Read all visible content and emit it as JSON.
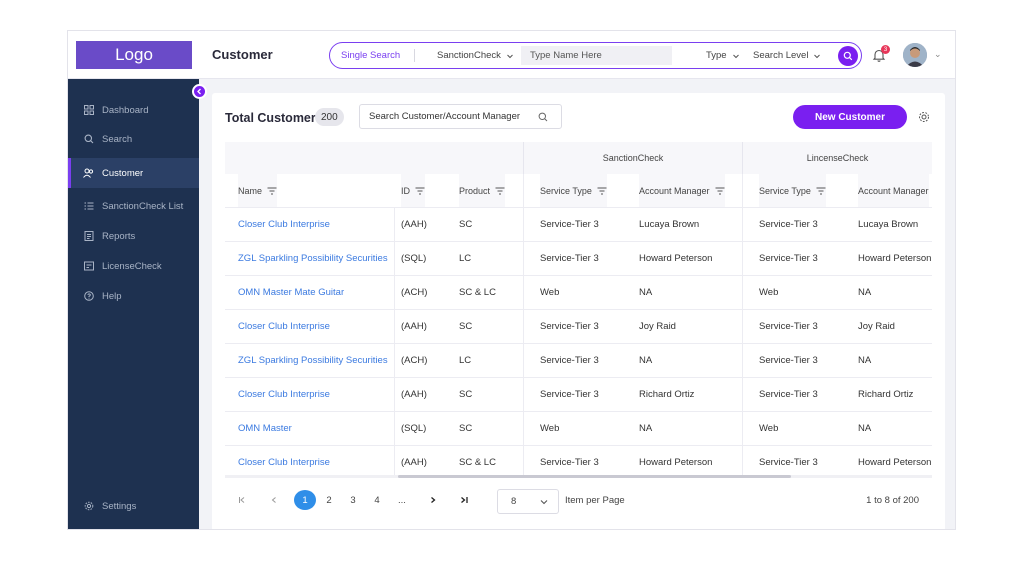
{
  "header": {
    "logo": "Logo",
    "page_title": "Customer",
    "search": {
      "mode": "Single Search",
      "source": "SanctionCheck",
      "placeholder": "Type Name Here",
      "type_label": "Type",
      "level_label": "Search Level"
    },
    "notification_count": "3"
  },
  "sidebar": {
    "items": [
      {
        "label": "Dashboard",
        "icon": "dashboard-icon"
      },
      {
        "label": "Search",
        "icon": "search-icon"
      },
      {
        "label": "Customer",
        "icon": "users-icon",
        "active": true
      },
      {
        "label": "SanctionCheck List",
        "icon": "list-icon"
      },
      {
        "label": "Reports",
        "icon": "report-icon"
      },
      {
        "label": "LicenseCheck",
        "icon": "license-icon"
      },
      {
        "label": "Help",
        "icon": "help-icon"
      }
    ],
    "settings_label": "Settings"
  },
  "main": {
    "title": "Total Customer",
    "count": "200",
    "search_placeholder": "Search Customer/Account Manager",
    "new_button": "New Customer",
    "table": {
      "groups": [
        "SanctionCheck",
        "LincenseCheck"
      ],
      "columns": [
        "Name",
        "ID",
        "Product",
        "Service Type",
        "Account Manager",
        "Service Type",
        "Account Manager"
      ],
      "rows": [
        [
          "Closer Club Interprise",
          "(AAH)",
          "SC",
          "Service-Tier 3",
          "Lucaya Brown",
          "Service-Tier 3",
          "Lucaya Brown"
        ],
        [
          "ZGL Sparkling Possibility Securities",
          "(SQL)",
          "LC",
          "Service-Tier 3",
          "Howard Peterson",
          "Service-Tier 3",
          "Howard Peterson"
        ],
        [
          "OMN Master Mate Guitar",
          "(ACH)",
          "SC & LC",
          "Web",
          "NA",
          "Web",
          "NA"
        ],
        [
          "Closer Club Interprise",
          "(AAH)",
          "SC",
          "Service-Tier 3",
          "Joy Raid",
          "Service-Tier 3",
          "Joy Raid"
        ],
        [
          "ZGL Sparkling Possibility Securities",
          "(ACH)",
          "LC",
          "Service-Tier 3",
          "NA",
          "Service-Tier 3",
          "NA"
        ],
        [
          "Closer Club Interprise",
          "(AAH)",
          "SC",
          "Service-Tier 3",
          "Richard  Ortiz",
          "Service-Tier 3",
          "Richard  Ortiz"
        ],
        [
          "OMN Master",
          "(SQL)",
          "SC",
          "Web",
          "NA",
          "Web",
          "NA"
        ],
        [
          "Closer Club Interprise",
          "(AAH)",
          "SC & LC",
          "Service-Tier 3",
          "Howard Peterson",
          "Service-Tier 3",
          "Howard Peterson"
        ]
      ]
    },
    "pagination": {
      "pages": [
        "1",
        "2",
        "3",
        "4",
        "..."
      ],
      "current": "1",
      "per_page": "8",
      "per_page_label": "Item per Page",
      "range": "1 to 8 of 200"
    }
  },
  "colors": {
    "accent": "#7a1ff0",
    "sidebar": "#1e3150",
    "link": "#3b7ae0",
    "logo_bg": "#6a4bc8"
  }
}
